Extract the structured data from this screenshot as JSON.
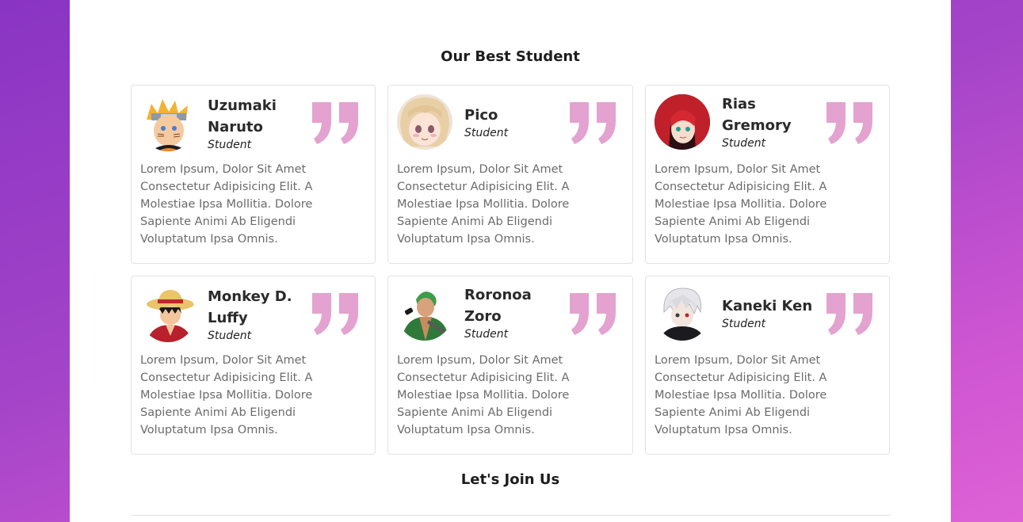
{
  "section_title": "Our Best Student",
  "footer_title": "Let's Join Us",
  "quote_color": "#e3a2cf",
  "students": [
    {
      "name": "Uzumaki Naruto",
      "role": "Student",
      "text": "Lorem Ipsum, Dolor Sit Amet Consectetur Adipisicing Elit. A Molestiae Ipsa Mollitia. Dolore Sapiente Animi Ab Eligendi Voluptatum Ipsa Omnis.",
      "avatar": "naruto-avatar"
    },
    {
      "name": "Pico",
      "role": "Student",
      "text": "Lorem Ipsum, Dolor Sit Amet Consectetur Adipisicing Elit. A Molestiae Ipsa Mollitia. Dolore Sapiente Animi Ab Eligendi Voluptatum Ipsa Omnis.",
      "avatar": "pico-avatar"
    },
    {
      "name": "Rias Gremory",
      "role": "Student",
      "text": "Lorem Ipsum, Dolor Sit Amet Consectetur Adipisicing Elit. A Molestiae Ipsa Mollitia. Dolore Sapiente Animi Ab Eligendi Voluptatum Ipsa Omnis.",
      "avatar": "rias-avatar"
    },
    {
      "name": "Monkey D. Luffy",
      "role": "Student",
      "text": "Lorem Ipsum, Dolor Sit Amet Consectetur Adipisicing Elit. A Molestiae Ipsa Mollitia. Dolore Sapiente Animi Ab Eligendi Voluptatum Ipsa Omnis.",
      "avatar": "luffy-avatar"
    },
    {
      "name": "Roronoa Zoro",
      "role": "Student",
      "text": "Lorem Ipsum, Dolor Sit Amet Consectetur Adipisicing Elit. A Molestiae Ipsa Mollitia. Dolore Sapiente Animi Ab Eligendi Voluptatum Ipsa Omnis.",
      "avatar": "zoro-avatar"
    },
    {
      "name": "Kaneki Ken",
      "role": "Student",
      "text": "Lorem Ipsum, Dolor Sit Amet Consectetur Adipisicing Elit. A Molestiae Ipsa Mollitia. Dolore Sapiente Animi Ab Eligendi Voluptatum Ipsa Omnis.",
      "avatar": "kaneki-avatar"
    }
  ]
}
